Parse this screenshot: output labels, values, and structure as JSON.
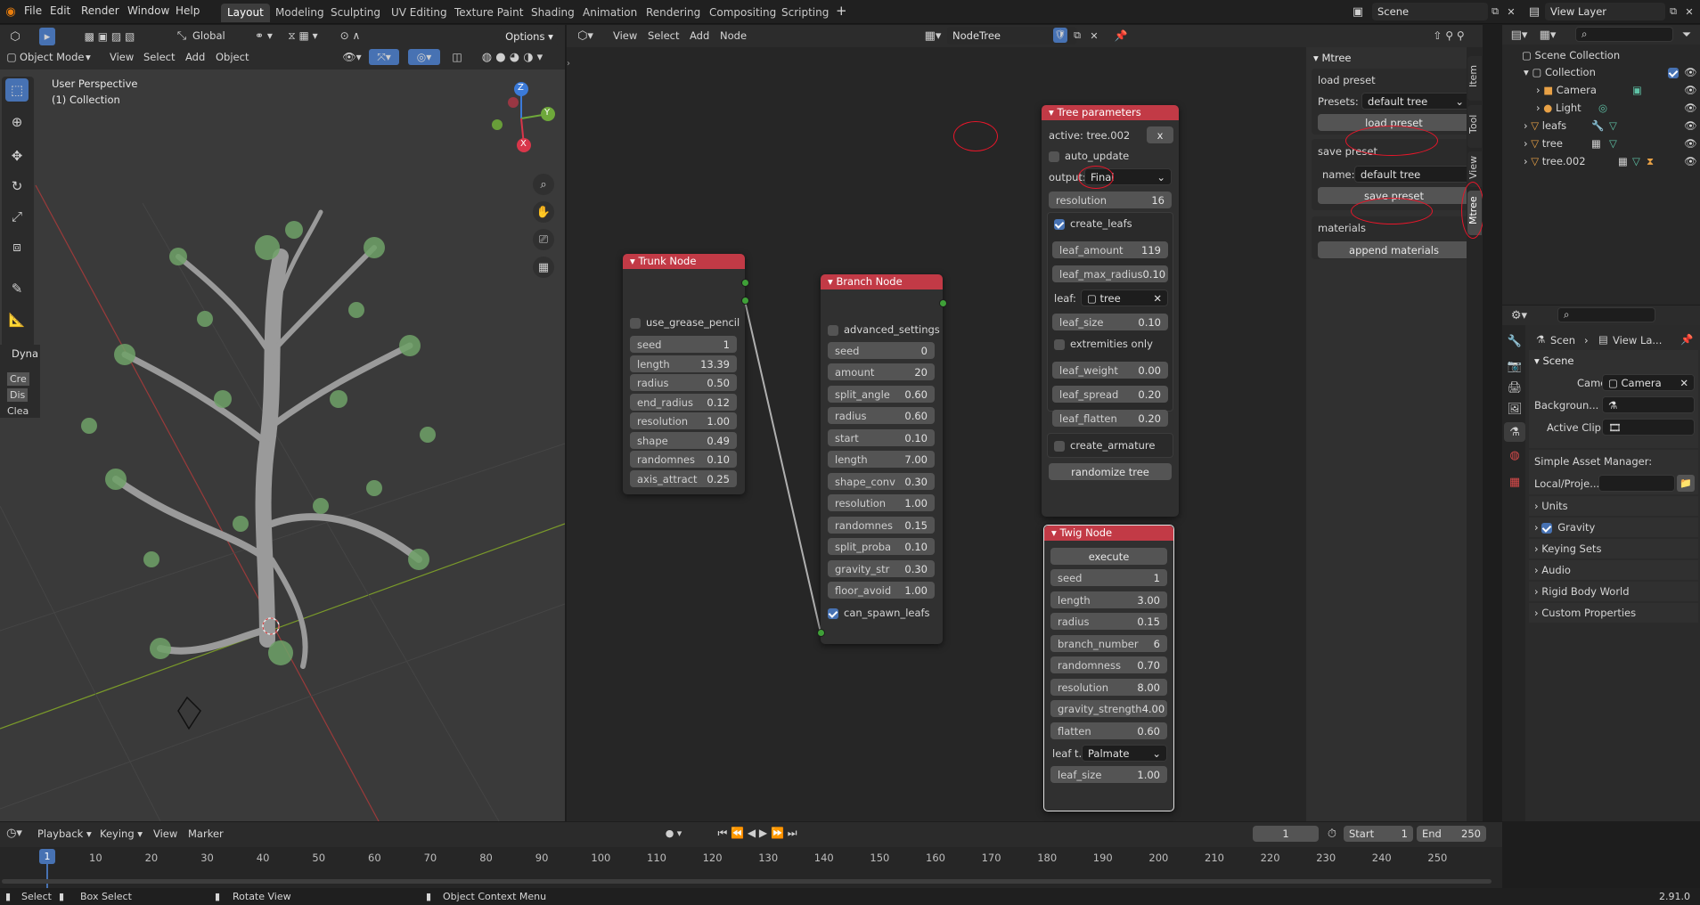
{
  "menubar": {
    "items": [
      "File",
      "Edit",
      "Render",
      "Window",
      "Help"
    ],
    "workspaces": [
      "Layout",
      "Modeling",
      "Sculpting",
      "UV Editing",
      "Texture Paint",
      "Shading",
      "Animation",
      "Rendering",
      "Compositing",
      "Scripting"
    ],
    "add_tab": "+",
    "scene": "Scene",
    "view_layer": "View Layer"
  },
  "viewport": {
    "header": {
      "mode": "Object Mode",
      "view": "View",
      "select": "Select",
      "add": "Add",
      "object": "Object",
      "orientation": "Global",
      "options": "Options"
    },
    "title": "User Perspective",
    "subtitle": "(1) Collection",
    "gizmo": {
      "z": "Z",
      "y": "Y",
      "x": "X"
    },
    "dyna_panel": {
      "title": "Dyna",
      "items": [
        "Cre",
        "Dis",
        "Clea"
      ]
    }
  },
  "node_editor": {
    "header": {
      "view": "View",
      "select": "Select",
      "add": "Add",
      "node": "Node",
      "tree_name": "NodeTree"
    },
    "trunk_node": {
      "title": "Trunk Node",
      "checkbox": "use_grease_pencil",
      "fields": [
        [
          "seed",
          "1"
        ],
        [
          "length",
          "13.39"
        ],
        [
          "radius",
          "0.50"
        ],
        [
          "end_radius",
          "0.12"
        ],
        [
          "resolution",
          "1.00"
        ],
        [
          "shape",
          "0.49"
        ],
        [
          "randomnes",
          "0.10"
        ],
        [
          "axis_attract",
          "0.25"
        ]
      ]
    },
    "branch_node": {
      "title": "Branch Node",
      "checkbox": "advanced_settings",
      "fields": [
        [
          "seed",
          "0"
        ],
        [
          "amount",
          "20"
        ],
        [
          "split_angle",
          "0.60"
        ],
        [
          "radius",
          "0.60"
        ],
        [
          "start",
          "0.10"
        ],
        [
          "length",
          "7.00"
        ],
        [
          "shape_conv",
          "0.30"
        ],
        [
          "resolution",
          "1.00"
        ],
        [
          "randomnes",
          "0.15"
        ],
        [
          "split_proba",
          "0.10"
        ],
        [
          "gravity_str",
          "0.30"
        ],
        [
          "floor_avoid",
          "1.00"
        ]
      ],
      "checkbox2": "can_spawn_leafs"
    },
    "tree_params": {
      "title": "Tree parameters",
      "active": "active: tree.002",
      "close": "x",
      "auto_update": "auto_update",
      "output_label": "output:",
      "output_value": "Final",
      "resolution": [
        "resolution",
        "16"
      ],
      "create_leafs": "create_leafs",
      "leaf_fields1": [
        [
          "leaf_amount",
          "119"
        ],
        [
          "leaf_max_radius",
          "0.10"
        ]
      ],
      "leaf_label": "leaf:",
      "leaf_value": "tree",
      "leaf_size": [
        "leaf_size",
        "0.10"
      ],
      "extremities": "extremities only",
      "leaf_fields2": [
        [
          "leaf_weight",
          "0.00"
        ],
        [
          "leaf_spread",
          "0.20"
        ],
        [
          "leaf_flatten",
          "0.20"
        ]
      ],
      "create_armature": "create_armature",
      "randomize": "randomize tree"
    },
    "twig_node": {
      "title": "Twig Node",
      "execute": "execute",
      "fields": [
        [
          "seed",
          "1"
        ],
        [
          "length",
          "3.00"
        ],
        [
          "radius",
          "0.15"
        ],
        [
          "branch_number",
          "6"
        ],
        [
          "randomness",
          "0.70"
        ],
        [
          "resolution",
          "8.00"
        ],
        [
          "gravity_strength",
          "4.00"
        ],
        [
          "flatten",
          "0.60"
        ]
      ],
      "leaf_type_label": "leaf t...",
      "leaf_type_value": "Palmate",
      "leaf_size": [
        "leaf_size",
        "1.00"
      ]
    }
  },
  "sidebar": {
    "title": "Mtree",
    "load_preset": {
      "title": "load preset",
      "presets_label": "Presets:",
      "presets_value": "default tree",
      "button": "load preset"
    },
    "save_preset": {
      "title": "save preset",
      "name_label": "name:",
      "name_value": "default tree",
      "button": "save preset"
    },
    "materials": {
      "title": "materials",
      "button": "append materials"
    },
    "tabs": [
      "Item",
      "Tool",
      "View",
      "Mtree"
    ]
  },
  "outliner": {
    "root": "Scene Collection",
    "items": [
      "Collection",
      "Camera",
      "Light",
      "leafs",
      "tree",
      "tree.002"
    ]
  },
  "properties": {
    "breadcrumb1": "Scen",
    "breadcrumb2": "View La...",
    "section": "Scene",
    "camera_label": "Camera",
    "camera_value": "Camera",
    "background_label": "Backgroun...",
    "active_clip_label": "Active Clip",
    "asset_manager": "Simple Asset Manager:",
    "local_label": "Local/Proje...",
    "panels": [
      "Units",
      "Gravity",
      "Keying Sets",
      "Audio",
      "Rigid Body World",
      "Custom Properties"
    ]
  },
  "timeline": {
    "playback": "Playback",
    "keying": "Keying",
    "view": "View",
    "marker": "Marker",
    "current_frame": "1",
    "start_label": "Start",
    "start": "1",
    "end_label": "End",
    "end": "250",
    "ruler": [
      "10",
      "20",
      "30",
      "40",
      "50",
      "60",
      "70",
      "80",
      "90",
      "100",
      "110",
      "120",
      "130",
      "140",
      "150",
      "160",
      "170",
      "180",
      "190",
      "200",
      "210",
      "220",
      "230",
      "240",
      "250"
    ],
    "playhead": "1"
  },
  "statusbar": {
    "select": "Select",
    "box_select": "Box Select",
    "rotate": "Rotate View",
    "context": "Object Context Menu",
    "version": "2.91.0"
  }
}
